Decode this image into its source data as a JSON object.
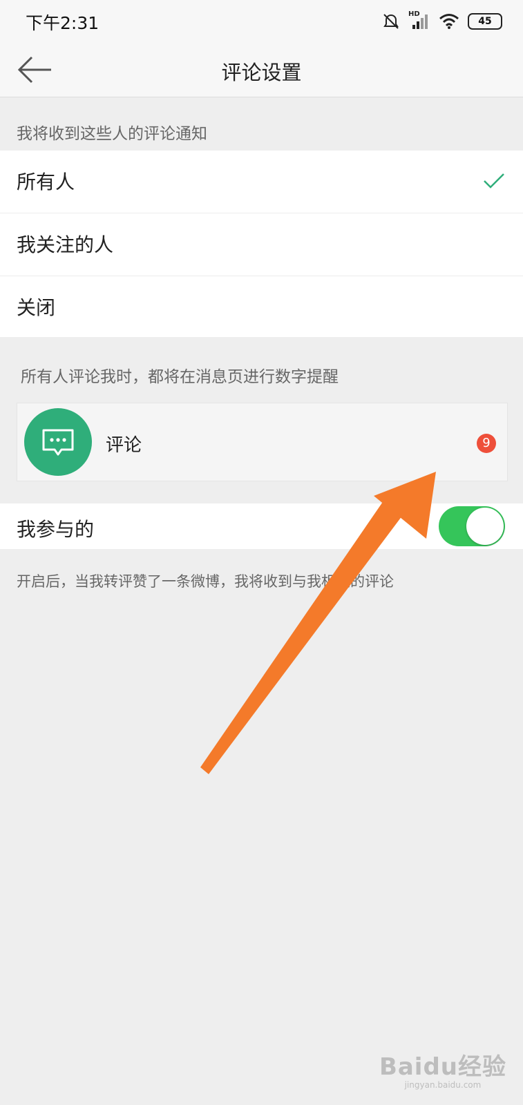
{
  "status_bar": {
    "time": "下午2:31",
    "signal_tag": "HD",
    "battery": "45",
    "icons": [
      "alarm-off-icon",
      "signal-icon",
      "wifi-icon",
      "battery-icon"
    ]
  },
  "header": {
    "title": "评论设置",
    "back_icon": "back-arrow-icon"
  },
  "notify_section": {
    "hint": "我将收到这些人的评论通知",
    "options": [
      {
        "label": "所有人",
        "selected": true
      },
      {
        "label": "我关注的人",
        "selected": false
      },
      {
        "label": "关闭",
        "selected": false
      }
    ]
  },
  "preview_section": {
    "hint": "所有人评论我时，都将在消息页进行数字提醒",
    "item_label": "评论",
    "badge_count": "9",
    "icon": "comment-bubble-icon"
  },
  "participate": {
    "label": "我参与的",
    "enabled": true,
    "description": "开启后，当我转评赞了一条微博，我将收到与我相关的评论"
  },
  "watermark": {
    "logo": "Baidu经验",
    "url": "jingyan.baidu.com"
  },
  "colors": {
    "accent_green": "#2fae7a",
    "switch_on": "#35c55a",
    "badge_red": "#ee4f3a",
    "annotation_arrow": "#f47a2a"
  }
}
